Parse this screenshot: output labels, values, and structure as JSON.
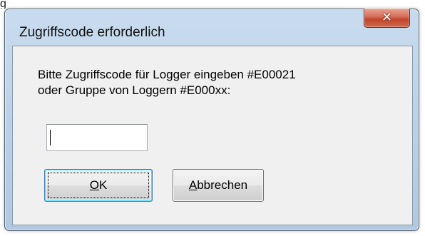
{
  "top_fragment": "g",
  "dialog": {
    "title": "Zugriffscode erforderlich",
    "close_glyph": "✕",
    "prompt_line1": "Bitte Zugriffscode für Logger eingeben #E00021",
    "prompt_line2": "oder Gruppe von Loggern #E000xx:",
    "code_input_value": "",
    "ok_button": {
      "mnemonic": "O",
      "rest": "K"
    },
    "cancel_button": {
      "mnemonic": "A",
      "rest": "bbrechen"
    }
  },
  "colors": {
    "title_bar": "#bfd4ea",
    "close_button": "#c94a32",
    "client_area": "#f0f0f0",
    "default_button_border": "#3c7fb1"
  },
  "icons": {
    "close": "close-icon"
  }
}
